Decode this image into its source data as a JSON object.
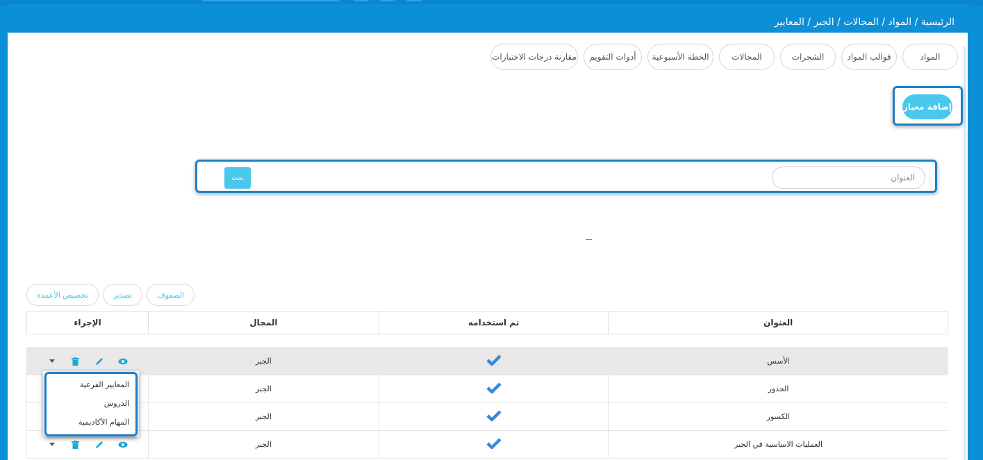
{
  "breadcrumb": "الرئيسية / المواد / المجالات / الجبر / المعايير",
  "tabs": [
    "المواد",
    "قوالب المواد",
    "الشجرات",
    "المجالات",
    "الخطة الأسبوعية",
    "أدوات التقويم",
    "مقارنة درجات الاختبارات"
  ],
  "add_button": "إضافة معيار",
  "search": {
    "placeholder": "العنوان",
    "button": "بحث"
  },
  "tools": {
    "columns": "تخصيص الأعمدة",
    "export": "تصدير",
    "rows": "الصفوف"
  },
  "table": {
    "headers": {
      "title": "العنوان",
      "used": "تم استخدامه",
      "domain": "المجال",
      "action": "الإجراء"
    },
    "rows": [
      {
        "title": "الأسس",
        "domain": "الجبر",
        "used": true
      },
      {
        "title": "الجذور",
        "domain": "الجبر",
        "used": true
      },
      {
        "title": "الكسور",
        "domain": "الجبر",
        "used": true
      },
      {
        "title": "العمليات الاساسية في الجبر",
        "domain": "الجبر",
        "used": true
      }
    ]
  },
  "dropdown": [
    "المعايير الفرعية",
    "الدروس",
    "المهام الأكاديمية"
  ],
  "colors": {
    "frame": "#0b8fd6",
    "accent": "#48c8ec",
    "highlight": "#1d7fc9",
    "check": "#3b8ad9"
  },
  "icons": {
    "view": "eye-icon",
    "edit": "pencil-icon",
    "delete": "trash-icon",
    "more": "caret-down-icon",
    "used": "check-icon"
  }
}
